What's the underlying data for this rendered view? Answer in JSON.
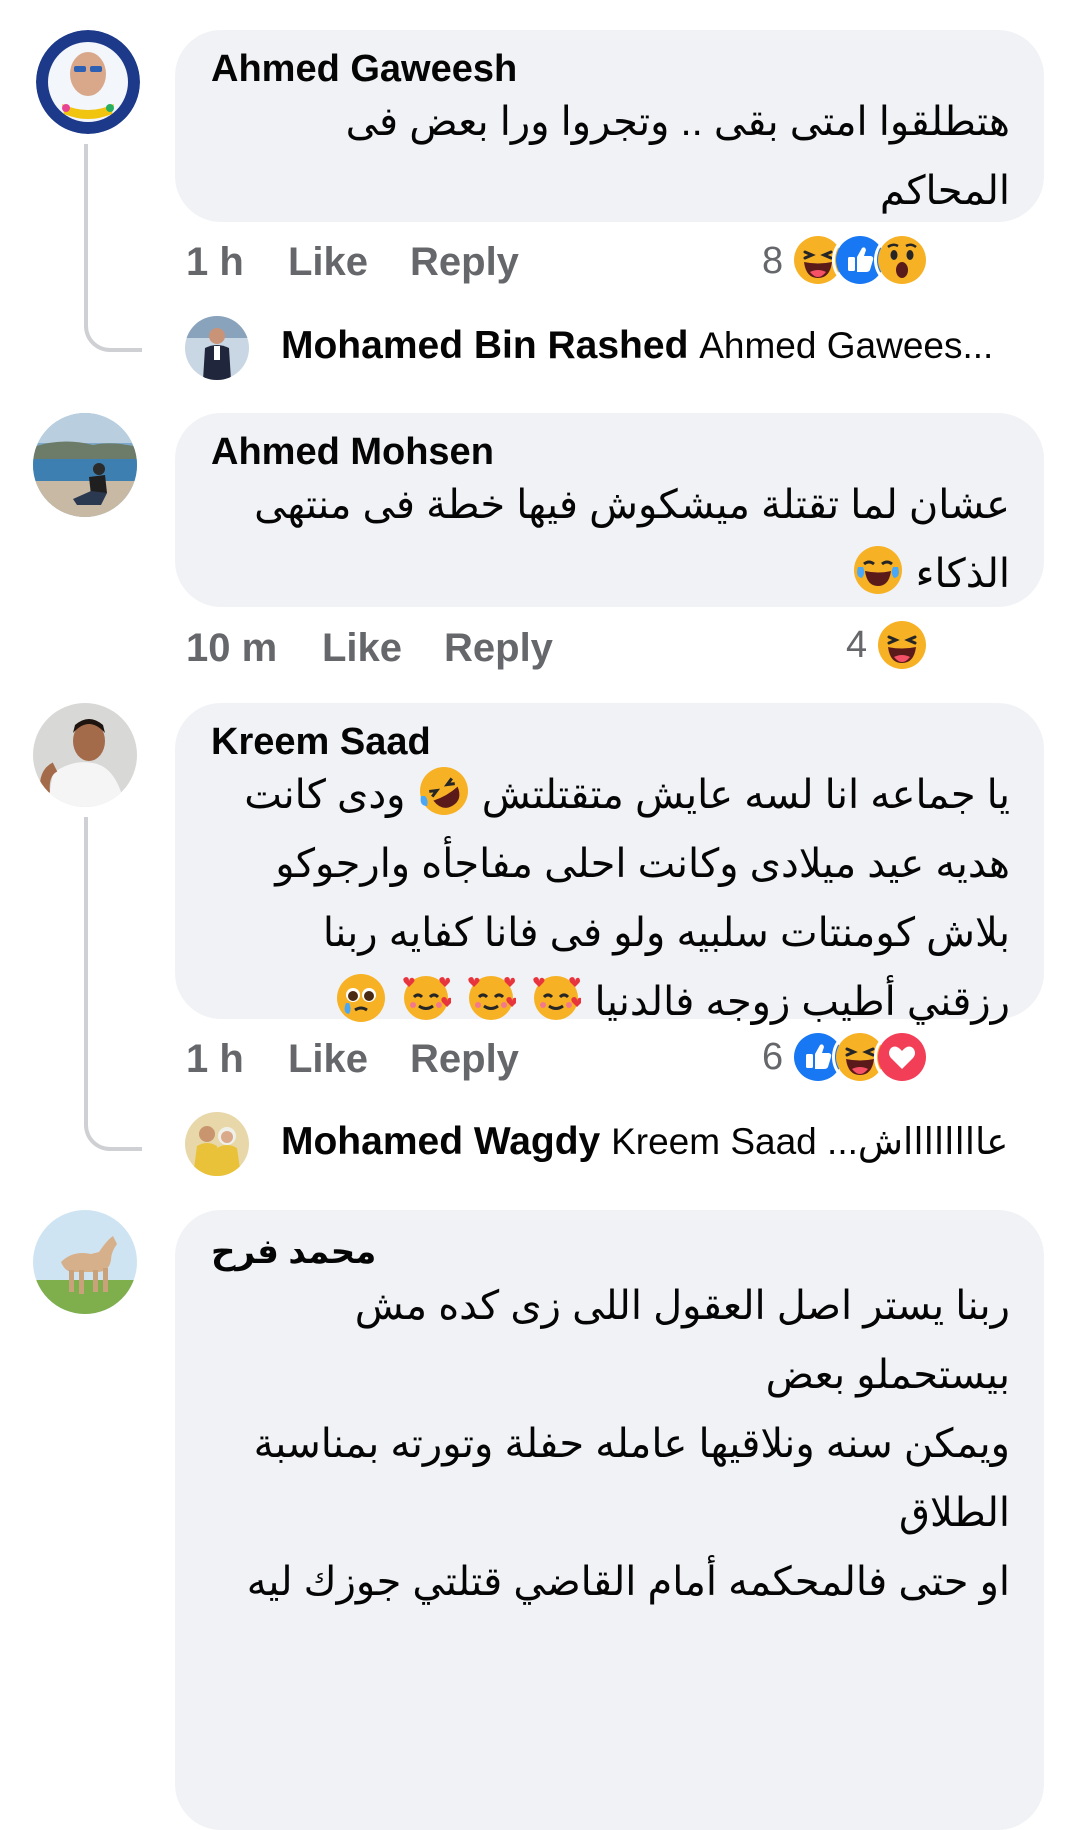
{
  "colors": {
    "bubble": "#f0f2f5",
    "meta": "#65676b",
    "like_blue": "#1877f2",
    "love_red": "#f33e58",
    "haha_yellow": "#f7b125",
    "thread_line": "#ced0d4"
  },
  "comments": [
    {
      "author": "Ahmed Gaweesh",
      "lines": [
        "هتطلقوا امتى بقى .. وتجروا ورا بعض فى",
        "المحاكم"
      ],
      "time": "1 h",
      "like": "Like",
      "reply": "Reply",
      "reaction_count": "8",
      "reaction_icons": [
        "haha-icon",
        "like-icon",
        "wow-icon"
      ],
      "reply_preview": {
        "name": "Mohamed Bin Rashed",
        "text": "Ahmed Gawees..."
      }
    },
    {
      "author": "Ahmed Mohsen",
      "lines": [
        "عشان لما تقتلة ميشكوش فيها خطة فى منتهى",
        "الذكاء"
      ],
      "time": "10 m",
      "like": "Like",
      "reply": "Reply",
      "reaction_count": "4",
      "reaction_icons": [
        "haha-icon"
      ]
    },
    {
      "author": "Kreem Saad",
      "lines": [
        "يا جماعه انا لسه عايش متقتلتش",
        "ودى كانت",
        "هديه عيد ميلادى وكانت احلى مفاجأه وارجوكو",
        "بلاش كومنتات سلبيه ولو فى فانا كفايه ربنا",
        "رزقني أطيب زوجه فالدنيا"
      ],
      "time": "1 h",
      "like": "Like",
      "reply": "Reply",
      "reaction_count": "6",
      "reaction_icons": [
        "like-icon",
        "haha-icon",
        "love-icon"
      ],
      "reply_preview": {
        "name": "Mohamed Wagdy",
        "text": "Kreem Saad ...عااااااااش"
      }
    },
    {
      "author": "محمد فرح",
      "lines": [
        "ربنا يستر اصل العقول اللى زى كده مش",
        "بيستحملو بعض",
        "ويمكن سنه ونلاقيها عامله حفلة وتورته بمناسبة",
        "الطلاق",
        "او حتى فالمحكمه أمام القاضي قتلتي جوزك ليه"
      ]
    }
  ]
}
